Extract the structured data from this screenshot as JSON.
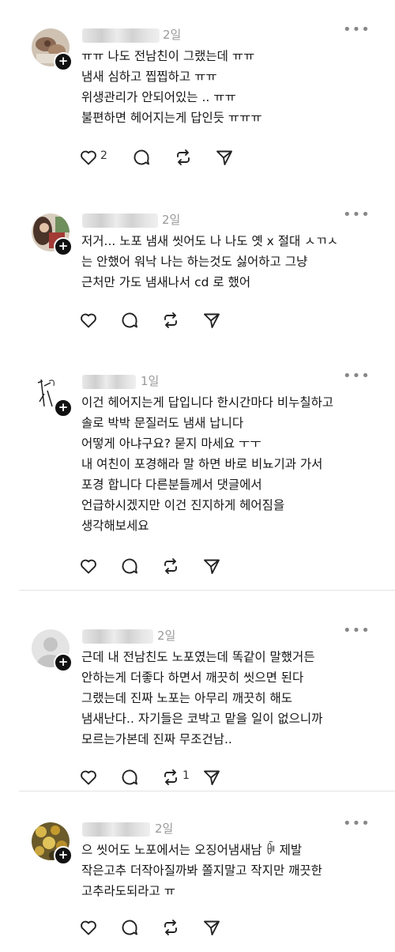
{
  "posts": [
    {
      "time": "2일",
      "lines": [
        "ㅠㅠ 나도 전남친이 그랬는데 ㅠㅠ",
        "냄새 심하고 찝찝하고 ㅠㅠ",
        "위생관리가 안되어있는 .. ㅠㅠ",
        "불편하면 헤어지는게 답인듯 ㅠㅠㅠ"
      ],
      "like_count": "2",
      "repost_count": ""
    },
    {
      "time": "2일",
      "lines": [
        "저거... 노포 냄새 씻어도 나  나도 옛 x 절대 ㅅㄲㅅ",
        "는 안했어 워낙 나는 하는것도 싫어하고 그냥",
        "근처만 가도 냄새나서 cd 로 했어"
      ],
      "like_count": "",
      "repost_count": ""
    },
    {
      "time": "1일",
      "lines": [
        "이건 헤어지는게 답입니다 한시간마다 비누칠하고",
        "솔로 박박 문질러도 냄새 납니다",
        "어떻게 아냐구요? 묻지 마세요 ㅜㅜ",
        "내 여친이 포경해라 말 하면 바로 비뇨기과 가서",
        "포경 합니다  다른분들께서 댓글에서",
        "언급하시겠지만 이건 진지하게 헤어짐을",
        "생각해보세요"
      ],
      "like_count": "",
      "repost_count": ""
    },
    {
      "time": "2일",
      "lines": [
        "근데 내 전남친도 노포였는데 똑같이 말했거든",
        "안하는게 더좋다 하면서 깨끗히 씻으면 된다",
        "그랬는데 진짜 노포는 아무리 깨끗히 해도",
        "냄새난다.. 자기들은 코박고 맡을 일이 없으니까",
        "모르는가본데 진짜 무조건남.."
      ],
      "like_count": "",
      "repost_count": "1"
    },
    {
      "time": "2일",
      "lines": [
        "으 씻어도 노포에서는 오징어냄새남 ꀼ 제발",
        "작은고추 더작아질까봐 쫄지말고 작지만 깨끗한",
        "고추라도되라고 ㅠ"
      ],
      "like_count": "",
      "repost_count": ""
    }
  ],
  "ui": {
    "more_label": "•••",
    "follow_label": "+"
  },
  "icons": {
    "like": "heart-icon",
    "reply": "comment-bubble-icon",
    "repost": "repost-icon",
    "share": "send-icon",
    "more": "more-options-icon"
  },
  "colors": {
    "text": "#151515",
    "muted": "#9a9a9a",
    "icon": "#222222",
    "divider": "#e3e3e3"
  }
}
